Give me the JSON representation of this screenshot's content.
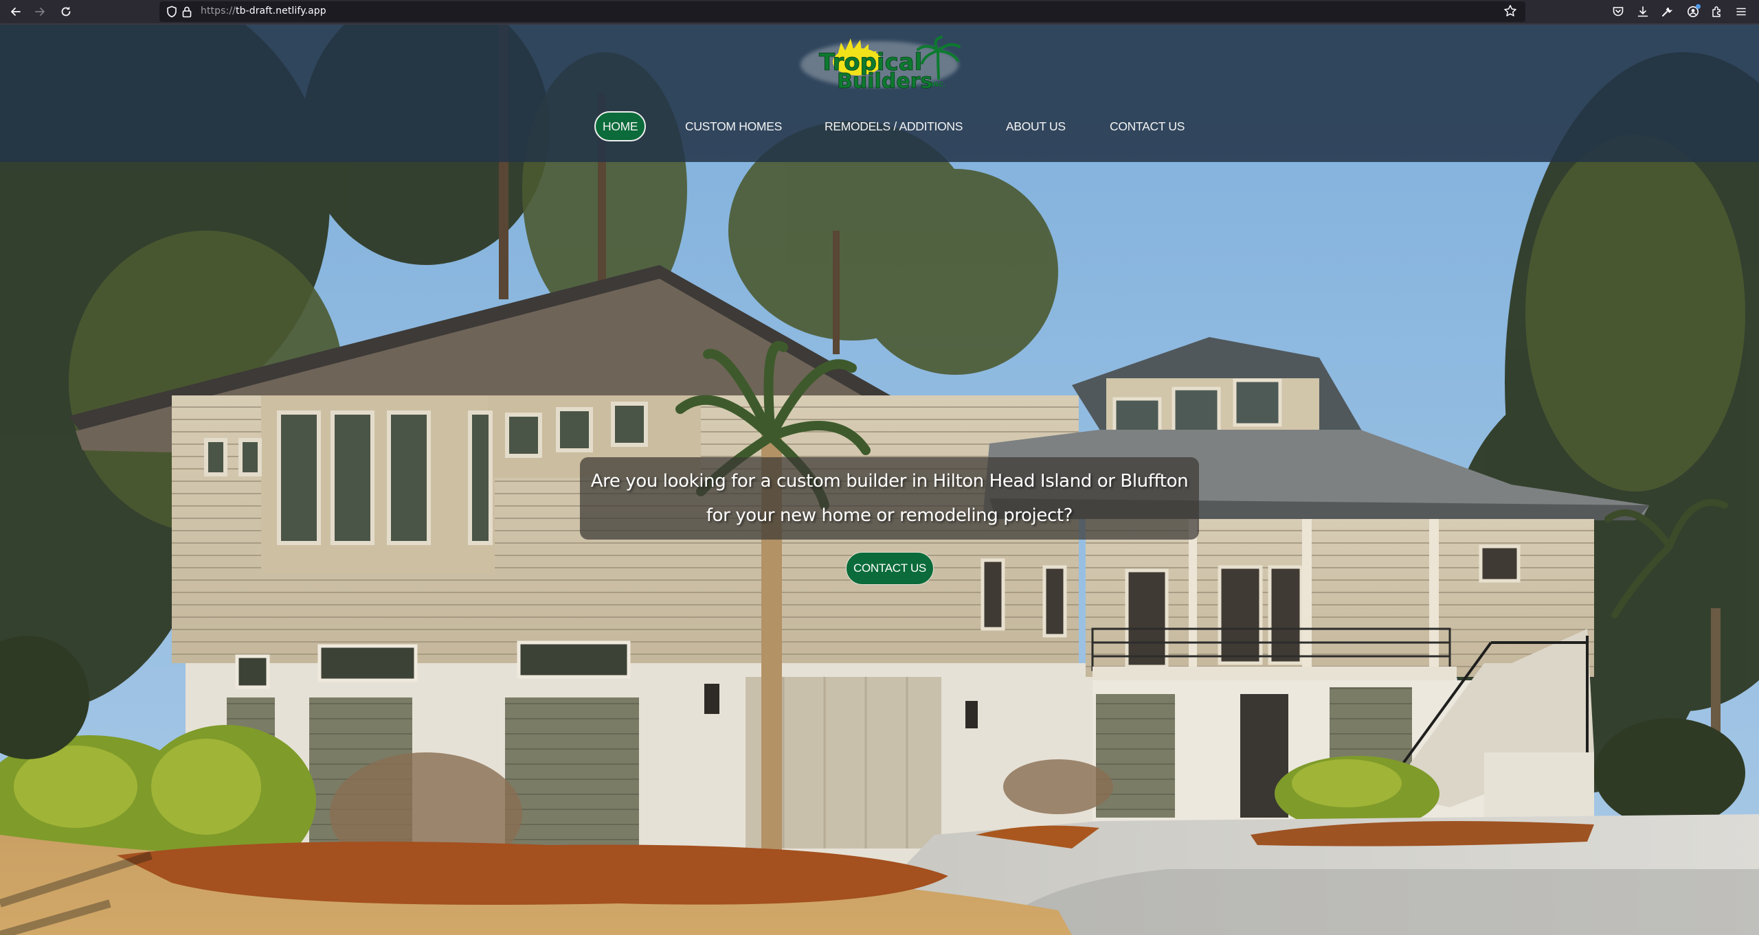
{
  "browser": {
    "url_scheme": "https://",
    "url_host": "tb-draft.netlify.app",
    "left_icons": [
      "back-arrow-icon",
      "forward-arrow-icon",
      "reload-icon"
    ],
    "url_icons": [
      "shield-icon",
      "lock-icon"
    ],
    "right_icons": [
      "pocket-icon",
      "download-icon",
      "wrench-icon",
      "account-icon",
      "extensions-icon",
      "menu-icon"
    ],
    "bookmark_icon": "star-icon"
  },
  "site": {
    "logo": {
      "line1": "Tropical",
      "line2": "Builders",
      "suffix": "INC."
    },
    "nav": [
      {
        "label": "HOME",
        "active": true
      },
      {
        "label": "CUSTOM HOMES",
        "active": false
      },
      {
        "label": "REMODELS / ADDITIONS",
        "active": false
      },
      {
        "label": "ABOUT US",
        "active": false
      },
      {
        "label": "CONTACT US",
        "active": false
      }
    ],
    "hero": {
      "line1": "Are you looking for a custom builder in Hilton Head Island or Bluffton",
      "line2": "for your new home or remodeling project?",
      "cta_label": "CONTACT US"
    },
    "colors": {
      "brand_green": "#0b6b3a",
      "header_overlay": "#233448",
      "logo_yellow": "#f2e21a"
    }
  }
}
